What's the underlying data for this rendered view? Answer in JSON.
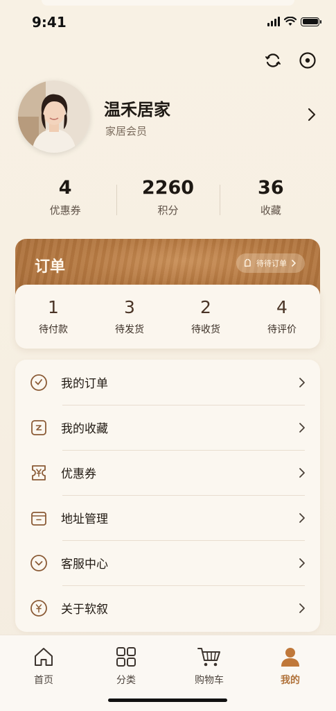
{
  "status": {
    "time": "9:41"
  },
  "profile": {
    "name": "温禾居家",
    "member": "家居会员"
  },
  "stats": [
    {
      "value": "4",
      "label": "优惠券"
    },
    {
      "value": "2260",
      "label": "积分"
    },
    {
      "value": "36",
      "label": "收藏"
    }
  ],
  "orders": {
    "title": "订单",
    "pending_label": "待待订单",
    "items": [
      {
        "count": "1",
        "label": "待付款"
      },
      {
        "count": "3",
        "label": "待发货"
      },
      {
        "count": "2",
        "label": "待收货"
      },
      {
        "count": "4",
        "label": "待评价"
      }
    ]
  },
  "menu": {
    "items": [
      {
        "label": "我的订单",
        "icon": "order-icon"
      },
      {
        "label": "我的收藏",
        "icon": "favorites-icon"
      },
      {
        "label": "优惠券",
        "icon": "coupon-icon"
      },
      {
        "label": "地址管理",
        "icon": "address-icon"
      },
      {
        "label": "客服中心",
        "icon": "service-icon"
      },
      {
        "label": "关于软叙",
        "icon": "about-icon"
      }
    ]
  },
  "tabs": [
    {
      "label": "首页",
      "icon": "home-icon"
    },
    {
      "label": "分类",
      "icon": "category-icon"
    },
    {
      "label": "购物车",
      "icon": "cart-icon"
    },
    {
      "label": "我的",
      "icon": "profile-icon",
      "active": true
    }
  ],
  "colors": {
    "accent": "#b0723a",
    "wood": "#b57840",
    "background": "#f7f0e3"
  }
}
